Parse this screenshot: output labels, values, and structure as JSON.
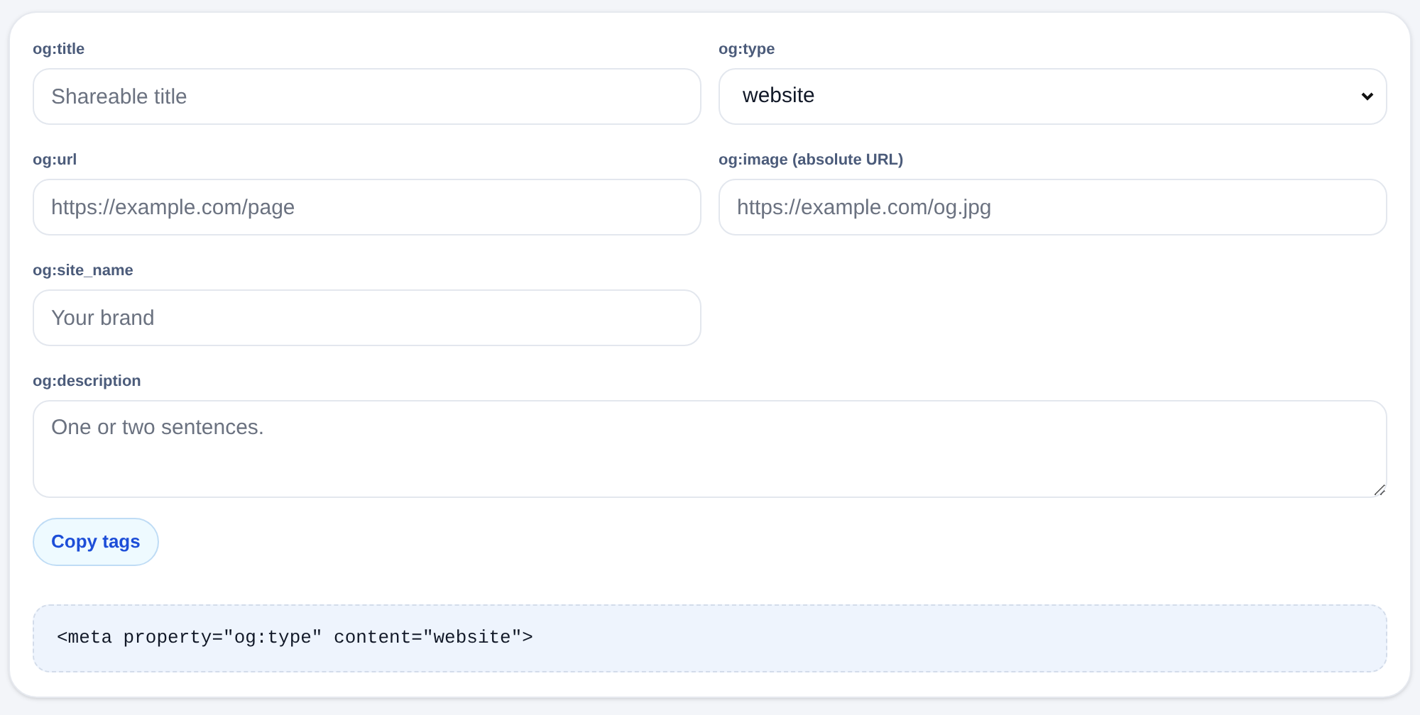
{
  "fields": [
    {
      "kind": "text",
      "label": "og:title",
      "placeholder": "Shareable title"
    },
    {
      "kind": "select",
      "label": "og:type",
      "value": "website"
    },
    {
      "kind": "text",
      "label": "og:url",
      "placeholder": "https://example.com/page"
    },
    {
      "kind": "text",
      "label": "og:image (absolute URL)",
      "placeholder": "https://example.com/og.jpg"
    },
    {
      "kind": "text",
      "label": "og:site_name",
      "placeholder": "Your brand"
    },
    {
      "kind": "textarea",
      "label": "og:description",
      "placeholder": "One or two sentences."
    }
  ],
  "copy_button": "Copy tags",
  "output": "<meta property=\"og:type\" content=\"website\">"
}
